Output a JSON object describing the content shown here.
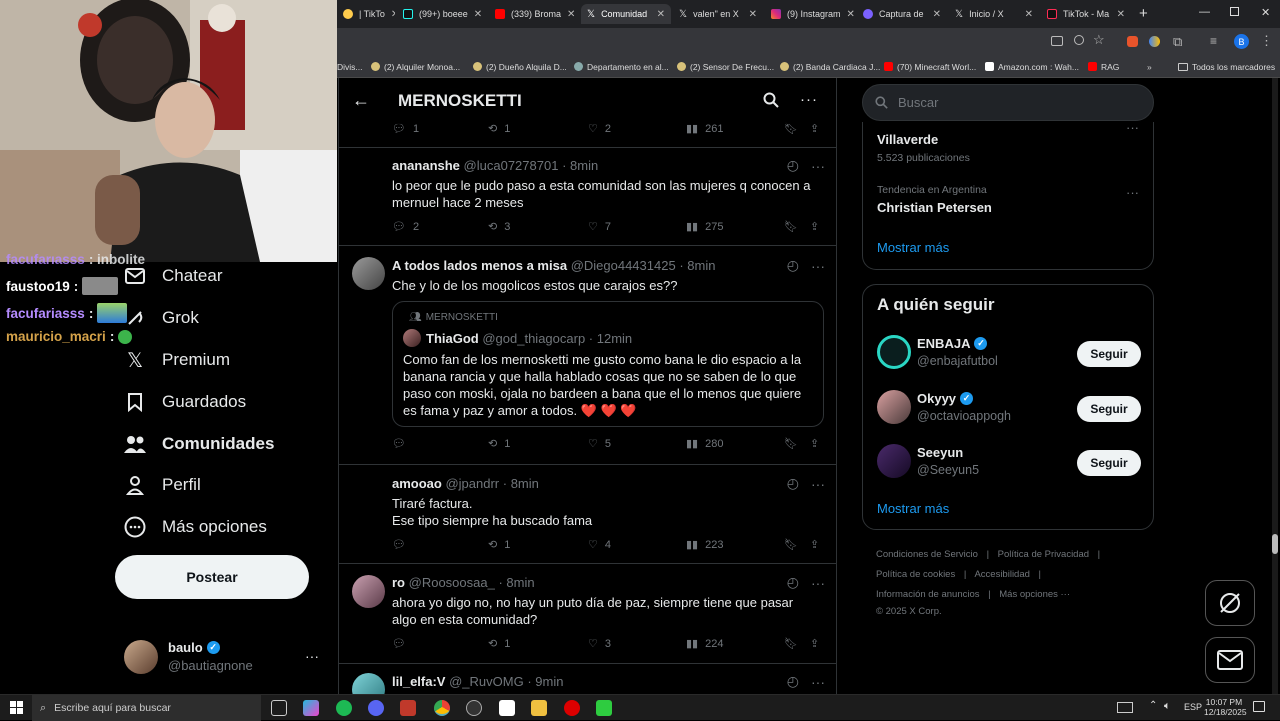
{
  "browser": {
    "tabs": [
      {
        "label": "| TikTo",
        "icon_color": "#ffcc4d"
      },
      {
        "label": "(99+) boeee",
        "icon_color": "#000000"
      },
      {
        "label": "(339) Broma",
        "icon_color": "#ff0000"
      },
      {
        "label": "Comunidad",
        "icon_color": "#000000",
        "active": true
      },
      {
        "label": "valen\" en X",
        "icon_color": "#000000"
      },
      {
        "label": "(9) Instagram",
        "icon_color": "#d6249f"
      },
      {
        "label": "Captura de",
        "icon_color": "#7b61ff"
      },
      {
        "label": "Inicio / X",
        "icon_color": "#000000"
      },
      {
        "label": "TikTok - Ma",
        "icon_color": "#000000"
      }
    ],
    "profile_initial": "B",
    "bookmarks": [
      {
        "label": "Divis..."
      },
      {
        "label": "(2) Alquiler Monoa..."
      },
      {
        "label": "(2) Dueño Alquila D..."
      },
      {
        "label": "Departamento en al..."
      },
      {
        "label": "(2) Sensor De Frecu..."
      },
      {
        "label": "(2) Banda Cardiaca J..."
      },
      {
        "label": "(70) Minecraft Worl..."
      },
      {
        "label": "Amazon.com : Wah..."
      },
      {
        "label": "RAG"
      },
      {
        "label": "Todos los marcadores"
      }
    ]
  },
  "chat": [
    {
      "user": "facufarıasss",
      "msg": ": inbolite",
      "color": "#b58cff"
    },
    {
      "user": "faustoo19",
      "msg": " :",
      "color": "#ffffff"
    },
    {
      "user": "facufariasss",
      "msg": " :",
      "color": "#b58cff"
    },
    {
      "user": "mauricio_macri",
      "msg": " :",
      "color": "#d4a24a"
    }
  ],
  "nav": {
    "items": [
      {
        "label": "Chatear",
        "icon": "mail-icon"
      },
      {
        "label": "Grok",
        "icon": "grok-icon"
      },
      {
        "label": "Premium",
        "icon": "x-logo-icon"
      },
      {
        "label": "Guardados",
        "icon": "bookmark-icon"
      },
      {
        "label": "Comunidades",
        "icon": "people-icon"
      },
      {
        "label": "Perfil",
        "icon": "person-icon"
      },
      {
        "label": "Más opciones",
        "icon": "more-circle-icon"
      }
    ],
    "post_button": "Postear",
    "account": {
      "name": "baulo",
      "handle": "@bautiagnone"
    }
  },
  "main": {
    "title": "MERNOSKETTI",
    "top_actions": {
      "replies": "1",
      "reposts": "1",
      "likes": "2",
      "views": "261"
    },
    "posts": [
      {
        "name": "anananshe",
        "handle": "@luca07278701",
        "time": "· 8min",
        "text": "lo peor que le pudo paso a esta comunidad son las mujeres q conocen a mernuel hace 2 meses",
        "replies": "2",
        "reposts": "3",
        "likes": "7",
        "views": "275"
      },
      {
        "name": "A todos lados menos a misa",
        "handle": "@Diego44431425",
        "time": "· 8min",
        "text": "Che y lo de los mogolicos estos que carajos es??",
        "quote": {
          "community": "MERNOSKETTI",
          "name": "ThiaGod",
          "handle": "@god_thiagocarp",
          "time": "· 12min",
          "text": "Como fan de los mernosketti me gusto como bana le dio espacio a la banana rancia y que halla hablado cosas que no se saben de lo que paso con moski, ojala no bardeen a bana que el lo menos que quiere es fama y paz y amor a todos. ❤️ ❤️ ❤️"
        },
        "replies": "",
        "reposts": "1",
        "likes": "5",
        "views": "280"
      },
      {
        "name": "amooao",
        "handle": "@jpandrr",
        "time": "· 8min",
        "text_lines": [
          "Tiraré factura.",
          "Ese tipo siempre ha buscado fama"
        ],
        "replies": "",
        "reposts": "1",
        "likes": "4",
        "views": "223"
      },
      {
        "name": "ro",
        "handle": "@Roosoosaa_",
        "time": "· 8min",
        "text": "ahora yo digo no, no hay un puto día de paz, siempre tiene que pasar algo en esta comunidad?",
        "replies": "",
        "reposts": "1",
        "likes": "3",
        "views": "224"
      },
      {
        "name": "lil_elfa:V",
        "handle": "@_RuvOMG",
        "time": "· 9min"
      }
    ]
  },
  "right": {
    "search_placeholder": "Buscar",
    "trends": [
      {
        "context": "Tendencia en Argentina",
        "name": "Villaverde",
        "count": "5.523 publicaciones"
      },
      {
        "context": "Tendencia en Argentina",
        "name": "Christian Petersen",
        "count": ""
      }
    ],
    "show_more": "Mostrar más",
    "follow_title": "A quién seguir",
    "follow": [
      {
        "name": "ENBAJA",
        "handle": "@enbajafutbol",
        "verified": true,
        "button": "Seguir"
      },
      {
        "name": "Okyyy",
        "handle": "@octavioappogh",
        "verified": true,
        "button": "Seguir"
      },
      {
        "name": "Seeyun",
        "handle": "@Seeyun5",
        "verified": false,
        "button": "Seguir"
      }
    ],
    "follow_more": "Mostrar más",
    "footer": {
      "terms": "Condiciones de Servicio",
      "privacy": "Política de Privacidad",
      "cookies": "Política de cookies",
      "accessibility": "Accesibilidad",
      "ads": "Información de anuncios",
      "more": "Más opciones ···",
      "copyright": "© 2025 X Corp."
    }
  },
  "taskbar": {
    "search_placeholder": "Escribe aquí para buscar",
    "lang": "ESP",
    "time": "10:07 PM",
    "date": "12/18/2025"
  },
  "colors": {
    "accent": "#1d9bf0",
    "heart": "#e0245e"
  }
}
